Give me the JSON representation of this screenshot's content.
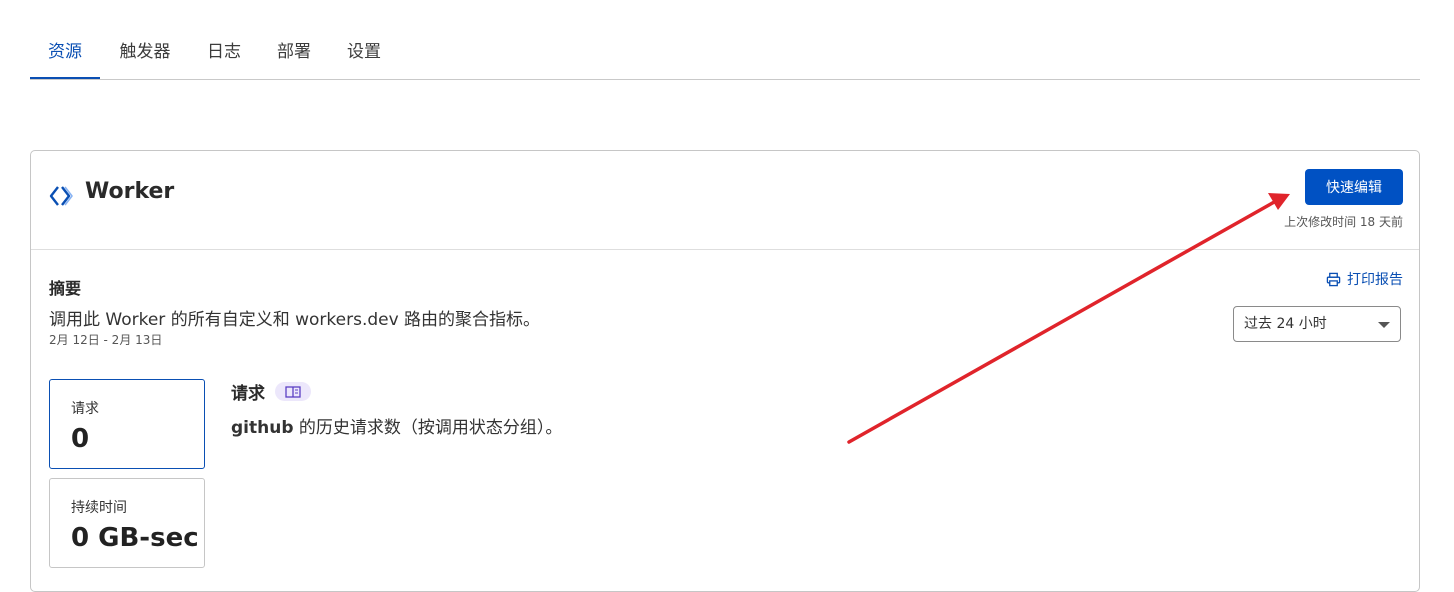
{
  "tabs": [
    {
      "label": "资源",
      "active": true
    },
    {
      "label": "触发器",
      "active": false
    },
    {
      "label": "日志",
      "active": false
    },
    {
      "label": "部署",
      "active": false
    },
    {
      "label": "设置",
      "active": false
    }
  ],
  "worker": {
    "icon": "worker-icon",
    "title": "Worker",
    "edit_button": "快速编辑",
    "last_modified": "上次修改时间 18 天前"
  },
  "summary": {
    "title": "摘要",
    "description": "调用此 Worker 的所有自定义和 workers.dev 路由的聚合指标。",
    "date_range": "2月 12日 - 2月 13日",
    "print_label": "打印报告",
    "time_range_selected": "过去 24 小时"
  },
  "metrics": [
    {
      "label": "请求",
      "value": "0"
    },
    {
      "label": "持续时间",
      "value": "0 GB-sec"
    }
  ],
  "requests": {
    "title": "请求",
    "script_name": "github",
    "description_rest": " 的历史请求数（按调用状态分组）。"
  },
  "colors": {
    "accent": "#0051c3",
    "annotation_arrow": "#e0242b"
  }
}
